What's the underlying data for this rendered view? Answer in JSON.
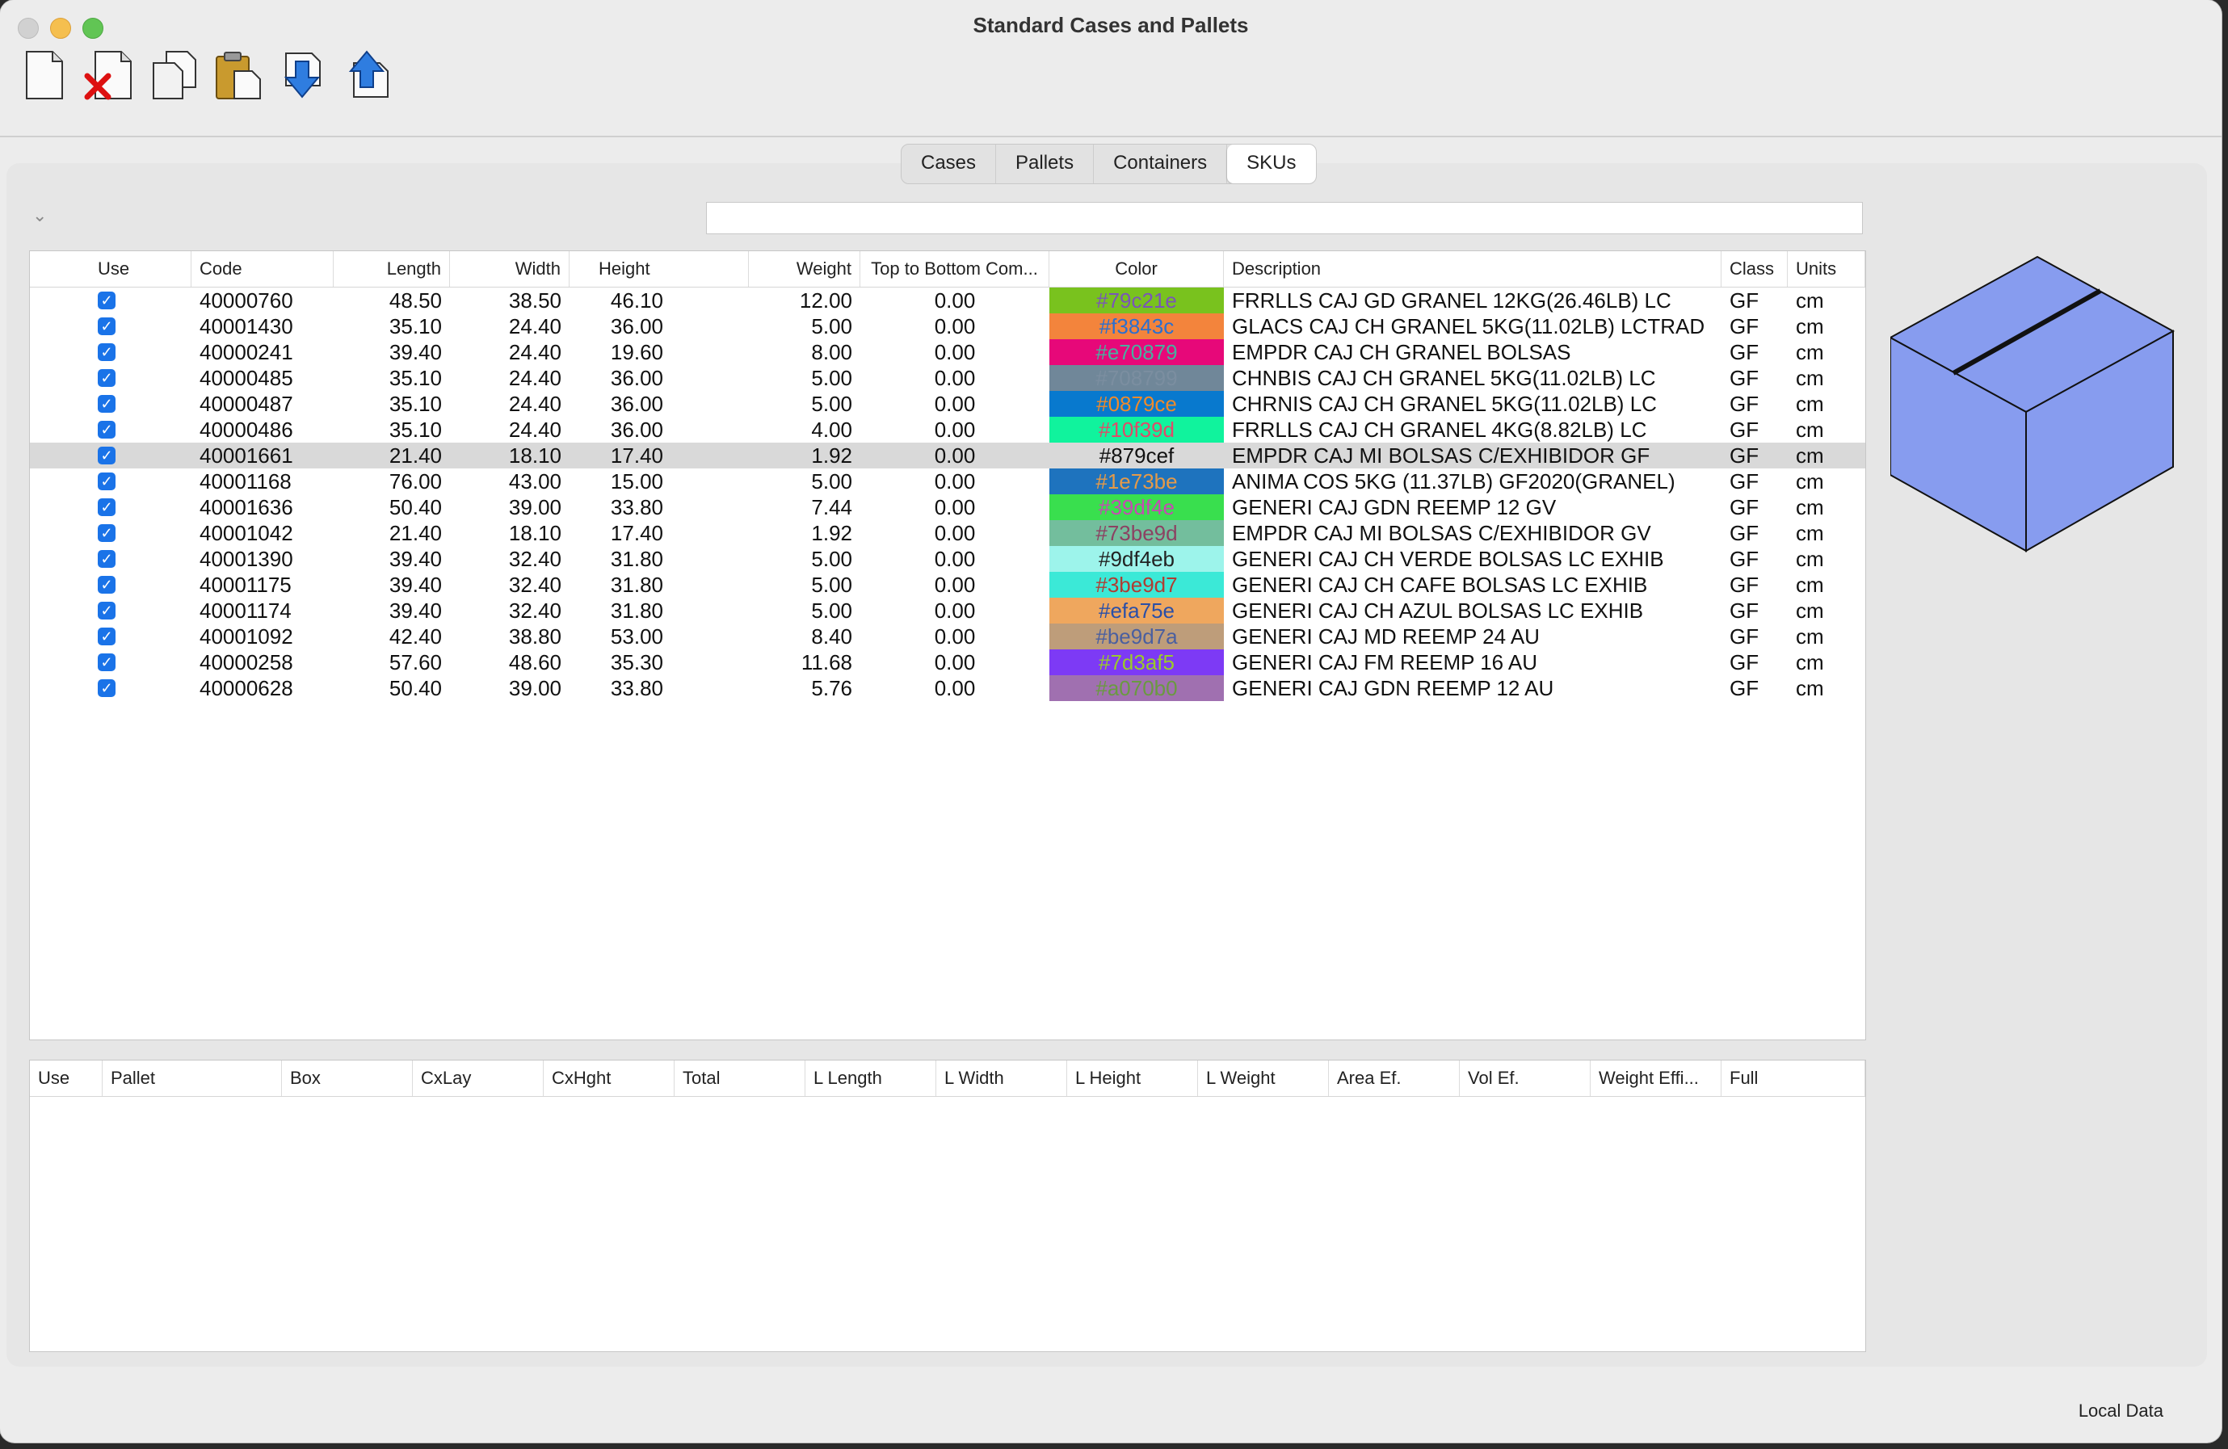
{
  "window": {
    "title": "Standard Cases and Pallets"
  },
  "toolbar": {
    "buttons": [
      {
        "name": "new-document-icon"
      },
      {
        "name": "delete-icon"
      },
      {
        "name": "copy-icon"
      },
      {
        "name": "paste-icon"
      },
      {
        "name": "import-arrow-down-icon"
      },
      {
        "name": "export-arrow-up-icon"
      }
    ]
  },
  "tabs": [
    {
      "label": "Cases"
    },
    {
      "label": "Pallets"
    },
    {
      "label": "Containers"
    },
    {
      "label": "SKUs",
      "active": true
    }
  ],
  "search": {
    "value": "",
    "placeholder": ""
  },
  "sku_table": {
    "columns": [
      "Use",
      "Code",
      "Length",
      "Width",
      "Height",
      "Weight",
      "Top to Bottom Com...",
      "Color",
      "Description",
      "Class",
      "Units"
    ],
    "selected_index": 6,
    "rows": [
      {
        "use": true,
        "code": "40000760",
        "length": "48.50",
        "width": "38.50",
        "height": "46.10",
        "weight": "12.00",
        "ttb": "0.00",
        "color": "#79c21e",
        "text_color": "#7a55b8",
        "description": "FRRLLS CAJ GD GRANEL 12KG(26.46LB) LC",
        "class": "GF",
        "units": "cm"
      },
      {
        "use": true,
        "code": "40001430",
        "length": "35.10",
        "width": "24.40",
        "height": "36.00",
        "weight": "5.00",
        "ttb": "0.00",
        "color": "#f3843c",
        "text_color": "#2a6fd0",
        "description": "GLACS CAJ CH GRANEL 5KG(11.02LB) LCTRAD",
        "class": "GF",
        "units": "cm"
      },
      {
        "use": true,
        "code": "40000241",
        "length": "39.40",
        "width": "24.40",
        "height": "19.60",
        "weight": "8.00",
        "ttb": "0.00",
        "color": "#e70879",
        "text_color": "#46b0a0",
        "description": "EMPDR CAJ CH GRANEL BOLSAS",
        "class": "GF",
        "units": "cm"
      },
      {
        "use": true,
        "code": "40000485",
        "length": "35.10",
        "width": "24.40",
        "height": "36.00",
        "weight": "5.00",
        "ttb": "0.00",
        "color": "#708799",
        "text_color": "#7b8ea0",
        "description": "CHNBIS CAJ CH GRANEL 5KG(11.02LB) LC",
        "class": "GF",
        "units": "cm"
      },
      {
        "use": true,
        "code": "40000487",
        "length": "35.10",
        "width": "24.40",
        "height": "36.00",
        "weight": "5.00",
        "ttb": "0.00",
        "color": "#0879ce",
        "text_color": "#f08a2a",
        "description": "CHRNIS CAJ CH GRANEL 5KG(11.02LB) LC",
        "class": "GF",
        "units": "cm"
      },
      {
        "use": true,
        "code": "40000486",
        "length": "35.10",
        "width": "24.40",
        "height": "36.00",
        "weight": "4.00",
        "ttb": "0.00",
        "color": "#10f39d",
        "text_color": "#e04a6a",
        "description": "FRRLLS CAJ CH GRANEL 4KG(8.82LB) LC",
        "class": "GF",
        "units": "cm"
      },
      {
        "use": true,
        "code": "40001661",
        "length": "21.40",
        "width": "18.10",
        "height": "17.40",
        "weight": "1.92",
        "ttb": "0.00",
        "color": "#d9d9d9",
        "text_color": "#111111",
        "color_label": "#879cef",
        "description": "EMPDR CAJ MI BOLSAS C/EXHIBIDOR GF",
        "class": "GF",
        "units": "cm"
      },
      {
        "use": true,
        "code": "40001168",
        "length": "76.00",
        "width": "43.00",
        "height": "15.00",
        "weight": "5.00",
        "ttb": "0.00",
        "color": "#1e73be",
        "text_color": "#e59a48",
        "description": "ANIMA COS 5KG (11.37LB) GF2020(GRANEL)",
        "class": "GF",
        "units": "cm"
      },
      {
        "use": true,
        "code": "40001636",
        "length": "50.40",
        "width": "39.00",
        "height": "33.80",
        "weight": "7.44",
        "ttb": "0.00",
        "color": "#39df4e",
        "text_color": "#c64ab3",
        "description": "GENERI CAJ GDN REEMP 12 GV",
        "class": "GF",
        "units": "cm"
      },
      {
        "use": true,
        "code": "40001042",
        "length": "21.40",
        "width": "18.10",
        "height": "17.40",
        "weight": "1.92",
        "ttb": "0.00",
        "color": "#73be9d",
        "text_color": "#8c4162",
        "description": "EMPDR CAJ MI BOLSAS C/EXHIBIDOR GV",
        "class": "GF",
        "units": "cm"
      },
      {
        "use": true,
        "code": "40001390",
        "length": "39.40",
        "width": "32.40",
        "height": "31.80",
        "weight": "5.00",
        "ttb": "0.00",
        "color": "#9df4eb",
        "text_color": "#222222",
        "description": "GENERI CAJ CH VERDE BOLSAS LC EXHIB",
        "class": "GF",
        "units": "cm"
      },
      {
        "use": true,
        "code": "40001175",
        "length": "39.40",
        "width": "32.40",
        "height": "31.80",
        "weight": "5.00",
        "ttb": "0.00",
        "color": "#3be9d7",
        "text_color": "#b03c32",
        "description": "GENERI CAJ CH CAFE BOLSAS LC EXHIB",
        "class": "GF",
        "units": "cm"
      },
      {
        "use": true,
        "code": "40001174",
        "length": "39.40",
        "width": "32.40",
        "height": "31.80",
        "weight": "5.00",
        "ttb": "0.00",
        "color": "#efa75e",
        "text_color": "#2a4fa8",
        "description": "GENERI CAJ CH AZUL BOLSAS LC EXHIB",
        "class": "GF",
        "units": "cm"
      },
      {
        "use": true,
        "code": "40001092",
        "length": "42.40",
        "width": "38.80",
        "height": "53.00",
        "weight": "8.40",
        "ttb": "0.00",
        "color": "#be9d7a",
        "text_color": "#4a5fa0",
        "description": "GENERI CAJ MD REEMP 24 AU",
        "class": "GF",
        "units": "cm"
      },
      {
        "use": true,
        "code": "40000258",
        "length": "57.60",
        "width": "48.60",
        "height": "35.30",
        "weight": "11.68",
        "ttb": "0.00",
        "color": "#7d3af5",
        "text_color": "#9acb2a",
        "description": "GENERI CAJ FM REEMP 16 AU",
        "class": "GF",
        "units": "cm"
      },
      {
        "use": true,
        "code": "40000628",
        "length": "50.40",
        "width": "39.00",
        "height": "33.80",
        "weight": "5.76",
        "ttb": "0.00",
        "color": "#a070b0",
        "text_color": "#6a9a40",
        "description": "GENERI CAJ GDN REEMP 12 AU",
        "class": "GF",
        "units": "cm"
      }
    ]
  },
  "pallet_table": {
    "columns": [
      "Use",
      "Pallet",
      "Box",
      "CxLay",
      "CxHght",
      "Total",
      "L Length",
      "L Width",
      "L Height",
      "L Weight",
      "Area Ef.",
      "Vol Ef.",
      "Weight Effi...",
      "Full"
    ],
    "rows": []
  },
  "preview": {
    "box_color": "#879cef"
  },
  "status": {
    "label": "Local Data"
  }
}
